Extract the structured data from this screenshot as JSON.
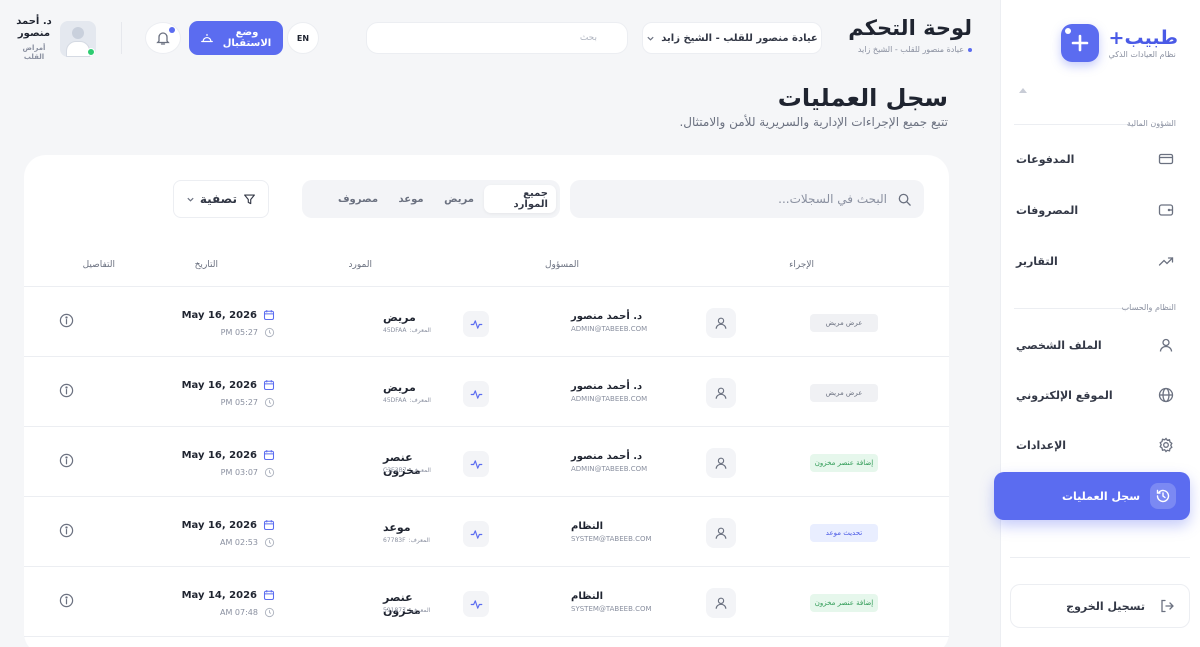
{
  "sidebar": {
    "brand_name": "طبيب+",
    "brand_sub": "نظام العيادات الذكي",
    "section_finance": "الشؤون المالية",
    "section_system": "النظام والحساب",
    "items": [
      {
        "label": "المدفوعات",
        "icon": "credit-card-icon"
      },
      {
        "label": "المصروفات",
        "icon": "wallet-icon"
      },
      {
        "label": "التقارير",
        "icon": "trend-up-icon"
      },
      {
        "label": "الملف الشخصي",
        "icon": "user-icon"
      },
      {
        "label": "الموقع الإلكتروني",
        "icon": "globe-icon"
      },
      {
        "label": "الإعدادات",
        "icon": "gear-icon"
      },
      {
        "label": "سجل العمليات",
        "icon": "history-icon",
        "active": true
      }
    ],
    "logout": "تسجيل الخروج"
  },
  "header": {
    "title": "لوحة التحكم",
    "subtitle": "عيادة منصور للقلب - الشيخ زايد",
    "clinic_select": "عيادة منصور للقلب - الشيخ زايد",
    "search_placeholder": "بحث",
    "lang": "EN",
    "reception_button": "وضع الاستقبال",
    "user_name": "د. أحمد منصور",
    "user_role": "أمراض القلب"
  },
  "page": {
    "title": "سجل العمليات",
    "subtitle": "تتبع جميع الإجراءات الإدارية والسريرية للأمن والامتثال."
  },
  "toolbar": {
    "search_placeholder": "البحث في السجلات...",
    "tabs": [
      "جميع الموارد",
      "مريض",
      "موعد",
      "مصروف"
    ],
    "filter": "تصفية"
  },
  "table": {
    "headers": {
      "action": "الإجراء",
      "responsible": "المسؤول",
      "resource": "المورد",
      "date": "التاريخ",
      "details": "التفاصيل"
    },
    "id_label": "المعرف:",
    "rows": [
      {
        "action": "عرض مريض",
        "action_type": "gray",
        "user": "د. أحمد منصور",
        "email": "ADMIN@TABEEB.COM",
        "resource": "مريض",
        "rid": "45DFAA",
        "date": "May 16, 2026",
        "time": "PM 05:27"
      },
      {
        "action": "عرض مريض",
        "action_type": "gray",
        "user": "د. أحمد منصور",
        "email": "ADMIN@TABEEB.COM",
        "resource": "مريض",
        "rid": "45DFAA",
        "date": "May 16, 2026",
        "time": "PM 05:27"
      },
      {
        "action": "إضافة عنصر مخزون",
        "action_type": "green",
        "user": "د. أحمد منصور",
        "email": "ADMIN@TABEEB.COM",
        "resource": "عنصر مخزون",
        "rid": "C3E3B7",
        "date": "May 16, 2026",
        "time": "PM 03:07"
      },
      {
        "action": "تحديث موعد",
        "action_type": "blue",
        "user": "النظام",
        "email": "SYSTEM@TABEEB.COM",
        "resource": "موعد",
        "rid": "67783F",
        "date": "May 16, 2026",
        "time": "AM 02:53"
      },
      {
        "action": "إضافة عنصر مخزون",
        "action_type": "green",
        "user": "النظام",
        "email": "SYSTEM@TABEEB.COM",
        "resource": "عنصر مخزون",
        "rid": "591877",
        "date": "May 14, 2026",
        "time": "AM 07:48"
      }
    ]
  },
  "colors": {
    "accent": "#5b6cf0",
    "green": "#2e9a55",
    "bg": "#f5f6f8"
  }
}
